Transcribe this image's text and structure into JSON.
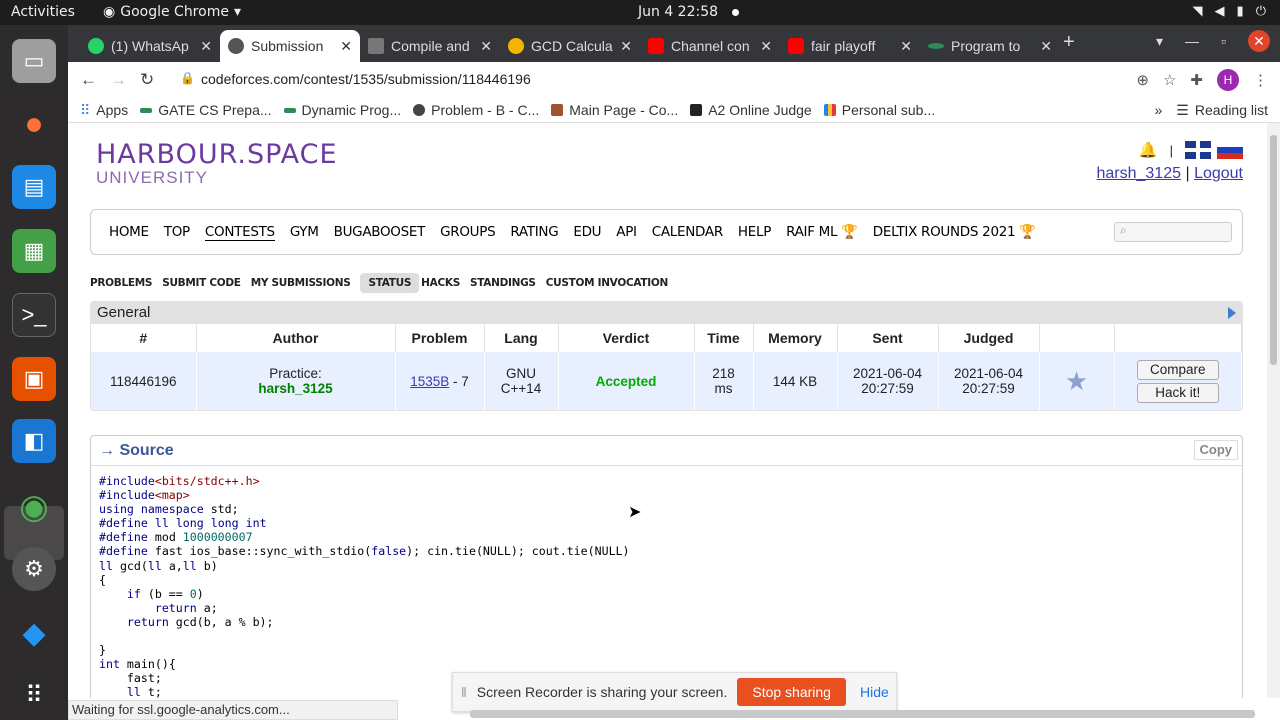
{
  "system": {
    "activities": "Activities",
    "app_name": "Google Chrome",
    "clock": "Jun 4  22:58"
  },
  "tabs": [
    {
      "title": "(1) WhatsAp",
      "color": "#25d366"
    },
    {
      "title": "Submission",
      "color": "#555555",
      "active": true
    },
    {
      "title": "Compile and",
      "color": "#777777"
    },
    {
      "title": "GCD Calcula",
      "color": "#f4b400"
    },
    {
      "title": "Channel con",
      "color": "#ff0000"
    },
    {
      "title": "fair playoff",
      "color": "#ff0000"
    },
    {
      "title": "Program to",
      "color": "#2e8b57"
    }
  ],
  "address": {
    "url": "codeforces.com/contest/1535/submission/118446196",
    "avatar": "H"
  },
  "bookmarks": [
    {
      "label": "Apps",
      "color": "#4285f4"
    },
    {
      "label": "GATE CS Prepa...",
      "color": "#2e8b57"
    },
    {
      "label": "Dynamic Prog...",
      "color": "#2e8b57"
    },
    {
      "label": "Problem - B - C...",
      "color": "#444444"
    },
    {
      "label": "Main Page - Co...",
      "color": "#a0522d"
    },
    {
      "label": "A2 Online Judge",
      "color": "#222222"
    },
    {
      "label": "Personal sub...",
      "color": "#1e88e5"
    }
  ],
  "reading_list": "Reading list",
  "site": {
    "logo_line1": "HARBOUR.SPACE",
    "logo_line2": "UNIVERSITY",
    "user": "harsh_3125",
    "separator": "|",
    "logout": "Logout",
    "menu": [
      "HOME",
      "TOP",
      "CONTESTS",
      "GYM",
      "BUGABOOSET",
      "GROUPS",
      "RATING",
      "EDU",
      "API",
      "CALENDAR",
      "HELP",
      "RAIF ML 🏆",
      "DELTIX ROUNDS 2021 🏆"
    ],
    "submenu": [
      "PROBLEMS",
      "SUBMIT CODE",
      "MY SUBMISSIONS",
      "STATUS",
      "HACKS",
      "STANDINGS",
      "CUSTOM INVOCATION"
    ]
  },
  "general": {
    "title": "General",
    "headers": [
      "#",
      "Author",
      "Problem",
      "Lang",
      "Verdict",
      "Time",
      "Memory",
      "Sent",
      "Judged",
      "",
      ""
    ],
    "row": {
      "id": "118446196",
      "author_prefix": "Practice:",
      "author": "harsh_3125",
      "problem_link": "1535B",
      "problem_suffix": " - 7",
      "lang_line1": "GNU",
      "lang_line2": "C++14",
      "verdict": "Accepted",
      "time_line1": "218",
      "time_line2": "ms",
      "memory": "144 KB",
      "sent_date": "2021-06-04",
      "sent_time": "20:27:59",
      "judged_date": "2021-06-04",
      "judged_time": "20:27:59",
      "compare": "Compare",
      "hack": "Hack it!"
    }
  },
  "source": {
    "title": "→ Source",
    "copy": "Copy",
    "lines": [
      "#include<bits/stdc++.h>",
      "#include<map>",
      "using namespace std;",
      "#define ll long long int",
      "#define mod 1000000007",
      "#define fast ios_base::sync_with_stdio(false); cin.tie(NULL); cout.tie(NULL)",
      "ll gcd(ll a,ll b)",
      "{",
      "    if (b == 0)",
      "        return a;",
      "    return gcd(b, a % b);",
      "",
      "}",
      "int main(){",
      "    fast;",
      "    ll t;"
    ]
  },
  "share": {
    "message": "Screen Recorder is sharing your screen.",
    "stop": "Stop sharing",
    "hide": "Hide"
  },
  "status_bar": "Waiting for ssl.google-analytics.com..."
}
